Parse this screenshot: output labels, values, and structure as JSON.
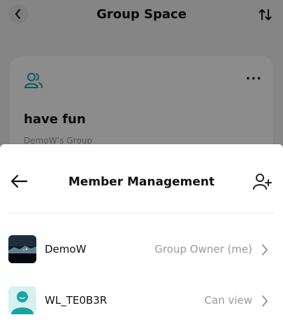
{
  "background_page": {
    "title": "Group Space",
    "group_card": {
      "name": "have fun",
      "subtitle": "DemoW’s Group",
      "more_label": "···"
    }
  },
  "sheet": {
    "title": "Member Management",
    "members": [
      {
        "name": "DemoW",
        "role": "Group Owner (me)",
        "avatar_icon": "landscape-photo-avatar"
      },
      {
        "name": "WL_TE0B3R",
        "role": "Can view",
        "avatar_icon": "default-person-avatar"
      }
    ]
  },
  "icons": {
    "back": "chevron-left-icon",
    "sort": "sort-icon",
    "group": "people-icon",
    "sheet_back": "arrow-left-icon",
    "add_member": "add-person-icon",
    "row_chevron": "chevron-right-icon"
  },
  "colors": {
    "accent": "#1aa3a3",
    "role_text": "#9a9a9a"
  }
}
